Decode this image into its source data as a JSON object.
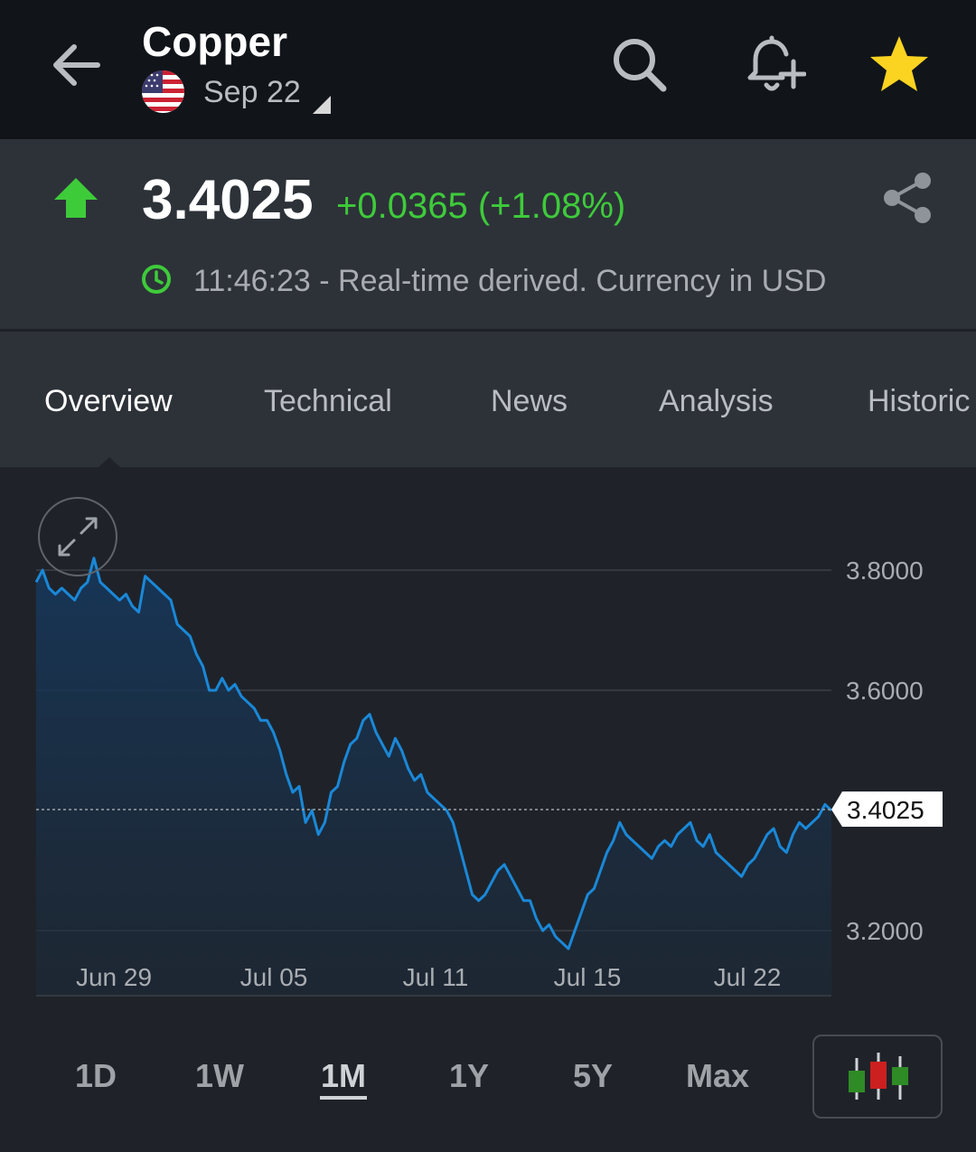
{
  "header": {
    "title": "Copper",
    "contract": "Sep 22",
    "icons": [
      "back-arrow-icon",
      "search-icon",
      "add-alert-icon",
      "star-icon"
    ]
  },
  "quote": {
    "price": "3.4025",
    "change": "+0.0365 (+1.08%)",
    "time_info": "11:46:23 - Real-time derived. Currency in USD",
    "colors": {
      "up": "#3ecb3a",
      "star": "#fbd321",
      "line": "#1a88d8"
    }
  },
  "tabs": [
    {
      "label": "Overview",
      "active": true
    },
    {
      "label": "Technical",
      "active": false
    },
    {
      "label": "News",
      "active": false
    },
    {
      "label": "Analysis",
      "active": false
    },
    {
      "label": "Historic",
      "active": false
    }
  ],
  "chart_data": {
    "type": "area",
    "yticks": [
      "3.8000",
      "3.6000",
      "3.2000"
    ],
    "ylim": [
      3.13,
      3.8
    ],
    "xticks": [
      "Jun 29",
      "Jul 05",
      "Jul 11",
      "Jul 15",
      "Jul 22"
    ],
    "current_label": "3.4025",
    "series": [
      {
        "values": [
          3.78,
          3.8,
          3.77,
          3.76,
          3.77,
          3.76,
          3.75,
          3.77,
          3.78,
          3.82,
          3.78,
          3.77,
          3.76,
          3.75,
          3.76,
          3.74,
          3.73,
          3.79,
          3.78,
          3.77,
          3.76,
          3.75,
          3.71,
          3.7,
          3.69,
          3.66,
          3.64,
          3.6,
          3.6,
          3.62,
          3.6,
          3.61,
          3.59,
          3.58,
          3.57,
          3.55,
          3.55,
          3.53,
          3.5,
          3.46,
          3.43,
          3.44,
          3.38,
          3.4,
          3.36,
          3.38,
          3.43,
          3.44,
          3.48,
          3.51,
          3.52,
          3.55,
          3.56,
          3.53,
          3.51,
          3.49,
          3.52,
          3.5,
          3.47,
          3.45,
          3.46,
          3.43,
          3.42,
          3.41,
          3.4,
          3.38,
          3.34,
          3.3,
          3.26,
          3.25,
          3.26,
          3.28,
          3.3,
          3.31,
          3.29,
          3.27,
          3.25,
          3.25,
          3.22,
          3.2,
          3.21,
          3.19,
          3.18,
          3.17,
          3.2,
          3.23,
          3.26,
          3.27,
          3.3,
          3.33,
          3.35,
          3.38,
          3.36,
          3.35,
          3.34,
          3.33,
          3.32,
          3.34,
          3.35,
          3.34,
          3.36,
          3.37,
          3.38,
          3.35,
          3.34,
          3.36,
          3.33,
          3.32,
          3.31,
          3.3,
          3.29,
          3.31,
          3.32,
          3.34,
          3.36,
          3.37,
          3.34,
          3.33,
          3.36,
          3.38,
          3.37,
          3.38,
          3.39,
          3.41,
          3.4
        ]
      }
    ]
  },
  "ranges": [
    {
      "label": "1D",
      "active": false
    },
    {
      "label": "1W",
      "active": false
    },
    {
      "label": "1M",
      "active": true
    },
    {
      "label": "1Y",
      "active": false
    },
    {
      "label": "5Y",
      "active": false
    },
    {
      "label": "Max",
      "active": false
    }
  ]
}
